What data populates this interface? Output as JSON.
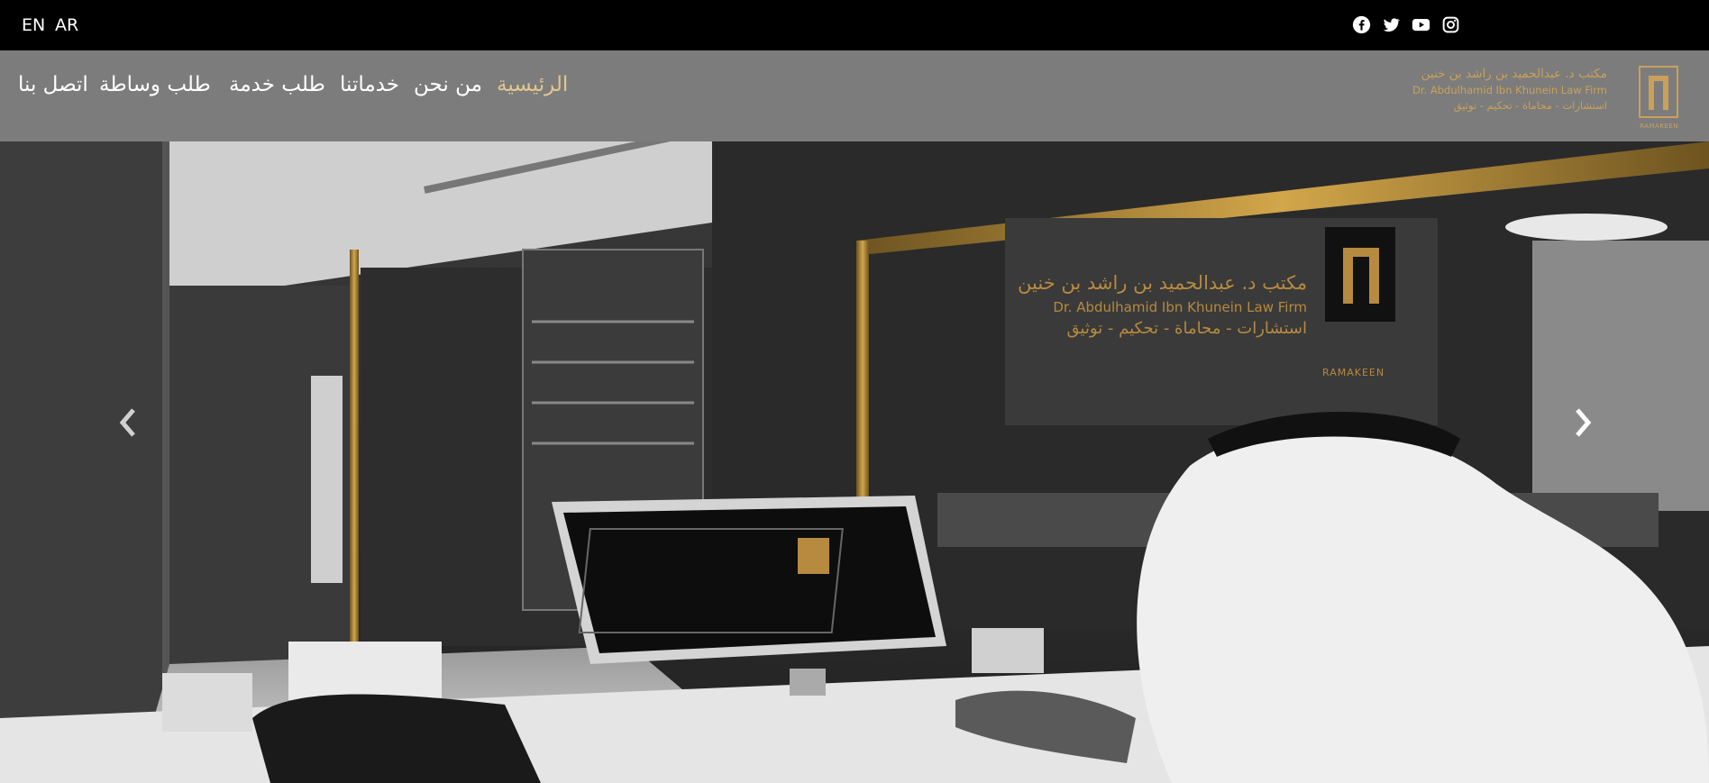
{
  "topbar": {
    "lang_en": "EN",
    "lang_ar": "AR",
    "social": [
      "facebook-icon",
      "twitter-icon",
      "youtube-icon",
      "instagram-icon"
    ]
  },
  "nav": {
    "home": "الرئيسية",
    "about": "من نحن",
    "services": "خدماتنا",
    "request_service": "طلب خدمة",
    "request_mediation": "طلب وساطة",
    "contact": "اتصل بنا"
  },
  "brand": {
    "name_ar": "مكتب د. عبدالحميد بن راشد بن خنين",
    "name_en": "Dr. Abdulhamid Ibn Khunein Law Firm",
    "tagline_ar": "استشارات - محاماة - تحكيم - توثيق",
    "mark_label": "RAMAKEEN"
  },
  "hero": {
    "sign_ar": "مكتب د. عبدالحميد بن راشد بن خنين",
    "sign_en": "Dr. Abdulhamid Ibn Khunein Law Firm",
    "sign_tagline_ar": "استشارات - محاماة - تحكيم - توثيق",
    "sign_mark_label": "RAMAKEEN"
  },
  "colors": {
    "accent_gold": "#e1c68f",
    "brand_gold": "#c9a15b",
    "navbar_bg": "#7c7c7c",
    "topbar_bg": "#000000"
  }
}
